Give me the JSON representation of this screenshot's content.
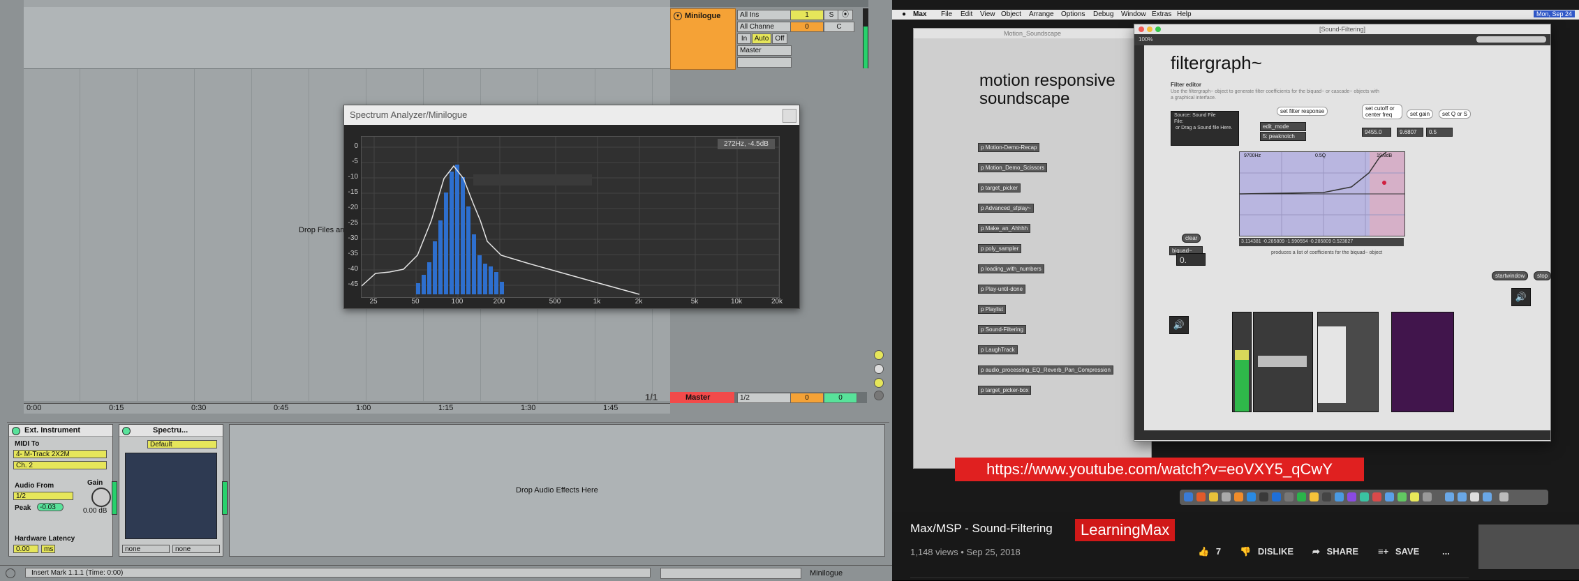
{
  "ableton": {
    "track": {
      "name": "Minilogue",
      "input_type": "All Ins",
      "input_channel": "All Channe",
      "monitor": [
        "In",
        "Auto",
        "Off"
      ],
      "output": "Master",
      "track_number": "1",
      "solo": "S",
      "volume": "0",
      "pan": "C"
    },
    "spectrum_window": {
      "title": "Spectrum Analyzer/Minilogue",
      "readout": "272Hz, -4.5dB",
      "db_ticks": [
        "0",
        "-5",
        "-10",
        "-15",
        "-20",
        "-25",
        "-30",
        "-35",
        "-40",
        "-45"
      ],
      "hz_ticks": [
        "25",
        "50",
        "100",
        "200",
        "500",
        "1k",
        "2k",
        "5k",
        "10k",
        "20k"
      ]
    },
    "drop_files_label": "Drop Files an",
    "timeline": [
      "0:00",
      "0:15",
      "0:30",
      "0:45",
      "1:00",
      "1:15",
      "1:30",
      "1:45"
    ],
    "loop_fraction": "1/1",
    "master": {
      "name": "Master",
      "output": "1/2",
      "volume": "0",
      "pan": "0"
    },
    "ext_instrument": {
      "title": "Ext. Instrument",
      "midi_to_label": "MIDI To",
      "midi_to_device": "4- M-Track 2X2M",
      "midi_channel": "Ch. 2",
      "audio_from_label": "Audio From",
      "audio_from_value": "1/2",
      "peak_label": "Peak",
      "peak_value": "-0.03",
      "gain_label": "Gain",
      "gain_value": "0.00 dB",
      "latency_label": "Hardware Latency",
      "latency_value": "0.00",
      "latency_unit": "ms"
    },
    "spectrum_device": {
      "title": "Spectru...",
      "preset": "Default",
      "sel_left": "none",
      "sel_right": "none"
    },
    "drop_audio_label": "Drop Audio Effects Here",
    "status_text": "Insert Mark 1.1.1 (Time: 0:00)",
    "status_track": "Minilogue"
  },
  "mac_menu": {
    "items": [
      "Max",
      "File",
      "Edit",
      "View",
      "Object",
      "Arrange",
      "Options",
      "Debug",
      "Window",
      "Extras",
      "Help"
    ],
    "clock": "Mon, Sep 24"
  },
  "max": {
    "soundscape_window_title": "Motion_Soundscape",
    "soundscape_title_line1": "motion responsive",
    "soundscape_title_line2": "soundscape",
    "patchers": [
      "p Motion-Demo-Recap",
      "p Motion_Demo_Scissors",
      "p target_picker",
      "p Advanced_sfplay~",
      "p Make_an_Ahhhh",
      "p poly_sampler",
      "p loading_with_numbers",
      "p Play-until-done",
      "p Playlist",
      "p Sound-Filtering",
      "p LaughTrack",
      "p audio_processing_EQ_Reverb_Pan_Compression",
      "p target_picker-box"
    ],
    "filter_window_title": "[Sound-Filtering]",
    "zoom": "100%",
    "filter_title": "filtergraph~",
    "filter_subtitle": "Filter editor",
    "filter_desc": "Use the filtergraph~ object to generate filter coefficients for the biquad~ or cascade~ objects with a graphical interface.",
    "bubbles": [
      "set filter response",
      "set cutoff or center freq",
      "set gain",
      "set Q or S"
    ],
    "edit_mode": "edit_mode",
    "filter_type": "5: peaknotch",
    "freq_val": "9455.0",
    "gain_val": "9.6807",
    "q_val": "0.5",
    "graph_freq_label": "9700Hz",
    "graph_q_label": "0.5Q",
    "graph_gain_label": "19.8dB",
    "coefficients": "3.114381 -0.285809 -1.590554 -0.285809 0.523827",
    "coef_caption": "produces a list of coefficients for the biquad~ object",
    "source": "Source: Sound File",
    "file": "File:",
    "drag_hint": "or Drag a Sound file Here.",
    "clear": "clear",
    "biquad": "biquad~",
    "big_number": "0.",
    "startwindow": "startwindow",
    "stop": "stop"
  },
  "youtube": {
    "url": "https://www.youtube.com/watch?v=eoVXY5_qCwY",
    "title": "Max/MSP - Sound-Filtering",
    "channel": "LearningMax",
    "views": "1,148 views • Sep 25, 2018",
    "likes": "7",
    "dislike": "DISLIKE",
    "share": "SHARE",
    "save": "SAVE",
    "more": "..."
  },
  "colors": {
    "track_orange": "#f5a236",
    "master_red": "#f24a4a",
    "yt_red": "#e02020",
    "spectrum_blue": "#2e6fce"
  }
}
